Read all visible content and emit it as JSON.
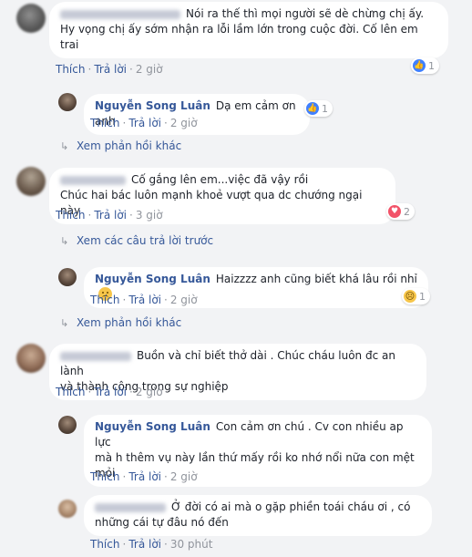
{
  "actions": {
    "like": "Thích",
    "reply": "Trả lời",
    "sep": "·"
  },
  "comments": [
    {
      "author": "",
      "text_first": "Nói ra thế thì mọi người sẽ dè chừng chị ấy.",
      "text_rest": "Hy vọng chị ấy sớm nhận ra lỗi lầm lớn trong cuộc đời. Cố lên em trai",
      "time": "2 giờ",
      "reaction_count": "1"
    },
    {
      "author": "Nguyễn Song Luân",
      "text": "Dạ em cảm ơn anh",
      "time": "2 giờ",
      "reaction_count": "1",
      "more_replies": "Xem phản hồi khác"
    },
    {
      "author": "",
      "text_first": "Cố gắng lên em...việc đã vậy rồi",
      "text_rest": "Chúc hai bác luôn mạnh khoẻ vượt qua dc chướng ngại này",
      "time": "3 giờ",
      "reaction_count": "2",
      "previous_replies": "Xem các câu trả lời trước"
    },
    {
      "author": "Nguyễn Song Luân",
      "text": "Haizzzz anh cũng biết khá lâu rồi nhỉ",
      "emoji": "sad-face-emoji",
      "time": "2 giờ",
      "reaction_count": "1",
      "more_replies": "Xem phản hồi khác"
    },
    {
      "author": "",
      "text_first": "Buồn và chỉ biết thở dài . Chúc cháu luôn đc an lành",
      "text_rest": "và thành công trong sự nghiệp",
      "time": "2 giờ"
    },
    {
      "author": "Nguyễn Song Luân",
      "text_first": "Con cảm ơn chú . Cv con nhiều ap lực",
      "text_rest": "mà h thêm vụ này lần thứ mấy rồi ko nhớ nổi nữa con mệt mỏi",
      "time": "2 giờ"
    },
    {
      "author": "",
      "text_first": "Ở đời có ai mà o gặp phiền toái cháu ơi , có",
      "text_rest": "những cái tự đâu nó đến",
      "time": "30 phút"
    }
  ],
  "colors": {
    "link": "#365899",
    "background": "#f2f3f5",
    "bubble": "#ffffff"
  }
}
